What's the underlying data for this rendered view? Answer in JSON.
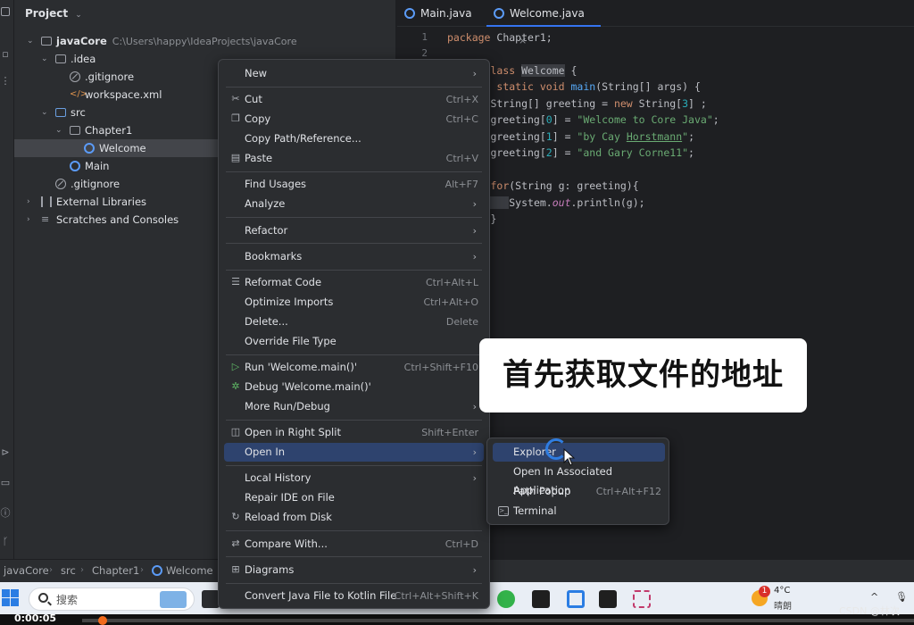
{
  "toolstrip": {
    "icons": [
      "project-icon",
      "structure-icon",
      "more-icon",
      "services-icon",
      "terminal-icon",
      "problems-icon",
      "git-icon"
    ]
  },
  "project": {
    "title": "Project",
    "tree": [
      {
        "label": "javaCore",
        "path": "C:\\Users\\happy\\IdeaProjects\\javaCore",
        "depth": 0,
        "expanded": true,
        "icon": "module-folder-icon"
      },
      {
        "label": ".idea",
        "depth": 1,
        "expanded": true,
        "icon": "folder-icon"
      },
      {
        "label": ".gitignore",
        "depth": 2,
        "icon": "gitignore-icon"
      },
      {
        "label": "workspace.xml",
        "depth": 2,
        "icon": "xml-icon"
      },
      {
        "label": "src",
        "depth": 1,
        "expanded": true,
        "icon": "source-folder-icon"
      },
      {
        "label": "Chapter1",
        "depth": 2,
        "expanded": true,
        "icon": "package-icon"
      },
      {
        "label": "Welcome",
        "depth": 3,
        "selected": true,
        "icon": "java-class-icon"
      },
      {
        "label": "Main",
        "depth": 2,
        "icon": "java-class-icon"
      },
      {
        "label": ".gitignore",
        "depth": 1,
        "icon": "gitignore-icon"
      },
      {
        "label": "External Libraries",
        "depth": 0,
        "expanded": false,
        "icon": "library-icon"
      },
      {
        "label": "Scratches and Consoles",
        "depth": 0,
        "expanded": false,
        "icon": "scratches-icon"
      }
    ]
  },
  "editor": {
    "tabs": [
      {
        "label": "Main.java",
        "active": false
      },
      {
        "label": "Welcome.java",
        "active": true,
        "close": "×"
      }
    ],
    "line_numbers": [
      "1",
      "2"
    ]
  },
  "context_menu": {
    "items": [
      {
        "label": "New",
        "submenu": true
      },
      {
        "sep": true
      },
      {
        "label": "Cut",
        "shortcut": "Ctrl+X",
        "icon": "scissors-icon"
      },
      {
        "label": "Copy",
        "shortcut": "Ctrl+C",
        "icon": "copy-icon"
      },
      {
        "label": "Copy Path/Reference..."
      },
      {
        "label": "Paste",
        "shortcut": "Ctrl+V",
        "icon": "paste-icon"
      },
      {
        "sep": true
      },
      {
        "label": "Find Usages",
        "shortcut": "Alt+F7"
      },
      {
        "label": "Analyze",
        "submenu": true
      },
      {
        "sep": true
      },
      {
        "label": "Refactor",
        "submenu": true
      },
      {
        "sep": true
      },
      {
        "label": "Bookmarks",
        "submenu": true
      },
      {
        "sep": true
      },
      {
        "label": "Reformat Code",
        "shortcut": "Ctrl+Alt+L",
        "icon": "reformat-icon"
      },
      {
        "label": "Optimize Imports",
        "shortcut": "Ctrl+Alt+O"
      },
      {
        "label": "Delete...",
        "shortcut": "Delete"
      },
      {
        "label": "Override File Type"
      },
      {
        "sep": true
      },
      {
        "label": "Run 'Welcome.main()'",
        "shortcut": "Ctrl+Shift+F10",
        "icon": "run-icon"
      },
      {
        "label": "Debug 'Welcome.main()'",
        "icon": "debug-icon"
      },
      {
        "label": "More Run/Debug",
        "submenu": true
      },
      {
        "sep": true
      },
      {
        "label": "Open in Right Split",
        "shortcut": "Shift+Enter",
        "icon": "split-icon"
      },
      {
        "label": "Open In",
        "submenu": true,
        "active": true
      },
      {
        "sep": true
      },
      {
        "label": "Local History",
        "submenu": true
      },
      {
        "label": "Repair IDE on File"
      },
      {
        "label": "Reload from Disk",
        "icon": "reload-icon"
      },
      {
        "sep": true
      },
      {
        "label": "Compare With...",
        "shortcut": "Ctrl+D",
        "icon": "compare-icon"
      },
      {
        "sep": true
      },
      {
        "label": "Diagrams",
        "submenu": true,
        "icon": "diagram-icon"
      },
      {
        "sep": true
      },
      {
        "label": "Convert Java File to Kotlin File",
        "shortcut": "Ctrl+Alt+Shift+K"
      }
    ]
  },
  "open_in_submenu": {
    "items": [
      {
        "label": "Explorer",
        "active": true
      },
      {
        "label": "Open In Associated Application"
      },
      {
        "label": "Path Popup",
        "shortcut": "Ctrl+Alt+F12"
      },
      {
        "label": "Terminal",
        "icon": "terminal-icon"
      }
    ]
  },
  "caption": "首先获取文件的地址",
  "breadcrumb": [
    "javaCore",
    "src",
    "Chapter1",
    "Welcome"
  ],
  "taskbar": {
    "search_placeholder": "搜索",
    "weather_badge": "1",
    "weather_temp": "4°C",
    "weather_desc": "晴朗",
    "tray_chevron": "^"
  },
  "video": {
    "time": "0:00:05"
  },
  "watermark": "CSDN @林次"
}
